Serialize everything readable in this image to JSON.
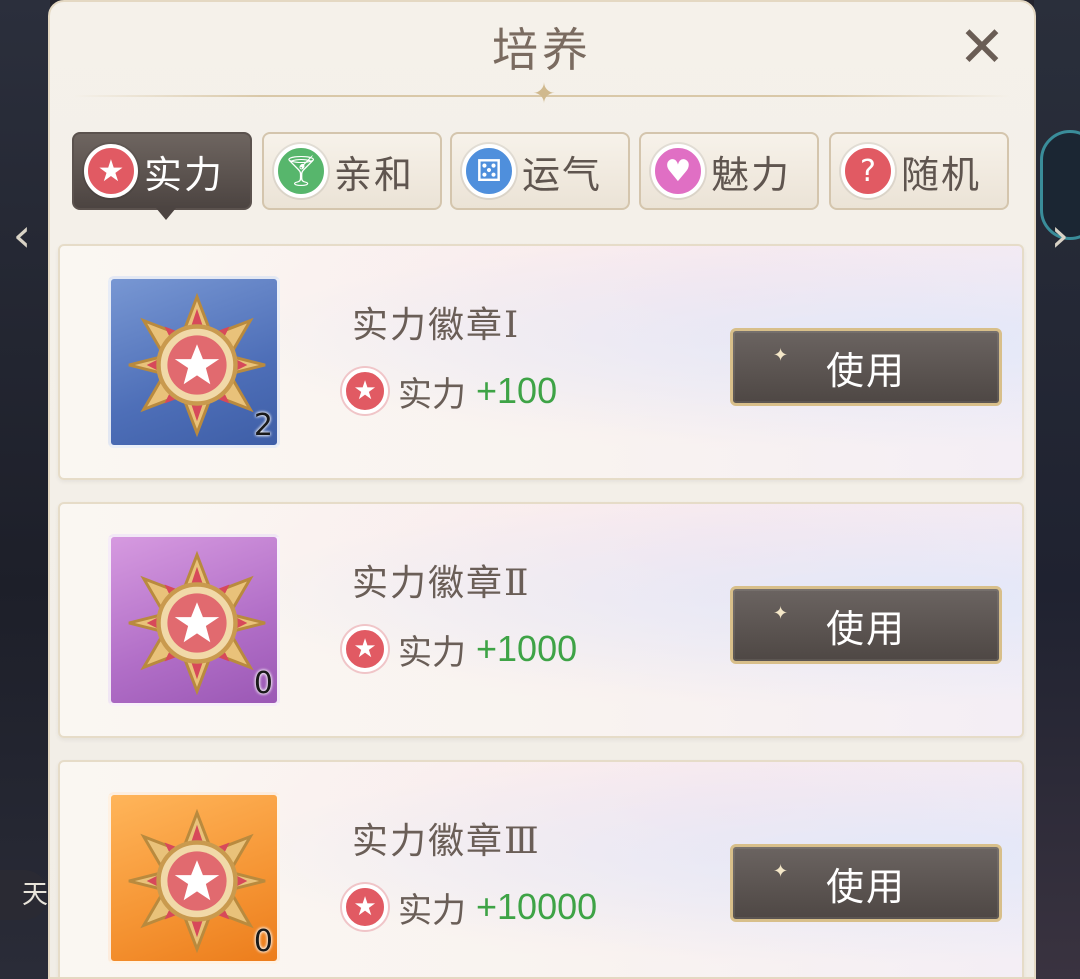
{
  "title": "培养",
  "tabs": [
    {
      "label": "实力",
      "icon": "star-icon",
      "color": "#e15a63",
      "active": true
    },
    {
      "label": "亲和",
      "icon": "cup-icon",
      "color": "#57b66c",
      "active": false
    },
    {
      "label": "运气",
      "icon": "dice-icon",
      "color": "#4f8fdc",
      "active": false
    },
    {
      "label": "魅力",
      "icon": "heart-icon",
      "color": "#e06fc4",
      "active": false
    },
    {
      "label": "随机",
      "icon": "question-icon",
      "color": "#e15a63",
      "active": false
    }
  ],
  "items": [
    {
      "name": "实力徽章Ⅰ",
      "count": "2",
      "stat_label": "实力",
      "stat_value": "+100",
      "use_label": "使用",
      "bg": "blue"
    },
    {
      "name": "实力徽章Ⅱ",
      "count": "0",
      "stat_label": "实力",
      "stat_value": "+1000",
      "use_label": "使用",
      "bg": "purple"
    },
    {
      "name": "实力徽章Ⅲ",
      "count": "0",
      "stat_label": "实力",
      "stat_value": "+10000",
      "use_label": "使用",
      "bg": "orange"
    }
  ],
  "side": {
    "left_label": "天"
  }
}
